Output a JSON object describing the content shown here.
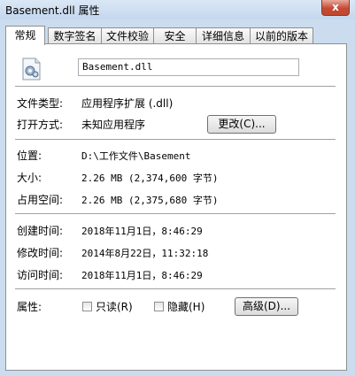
{
  "window": {
    "title": "Basement.dll 属性",
    "close_label": "x"
  },
  "tabs": [
    "常规",
    "数字签名",
    "文件校验",
    "安全",
    "详细信息",
    "以前的版本"
  ],
  "general": {
    "file_name": "Basement.dll",
    "file_type_label": "文件类型:",
    "file_type_value": "应用程序扩展 (.dll)",
    "open_with_label": "打开方式:",
    "open_with_value": "未知应用程序",
    "change_button": "更改(C)...",
    "location_label": "位置:",
    "location_value": "D:\\工作文件\\Basement",
    "size_label": "大小:",
    "size_value": "2.26 MB (2,374,600 字节)",
    "size_on_disk_label": "占用空间:",
    "size_on_disk_value": "2.26 MB (2,375,680 字节)",
    "created_label": "创建时间:",
    "created_value": "2018年11月1日，8:46:29",
    "modified_label": "修改时间:",
    "modified_value": "2014年8月22日，11:32:18",
    "accessed_label": "访问时间:",
    "accessed_value": "2018年11月1日，8:46:29",
    "attributes_label": "属性:",
    "readonly_label": "只读(R)",
    "readonly_checked": false,
    "hidden_label": "隐藏(H)",
    "hidden_checked": false,
    "advanced_button": "高级(D)..."
  }
}
